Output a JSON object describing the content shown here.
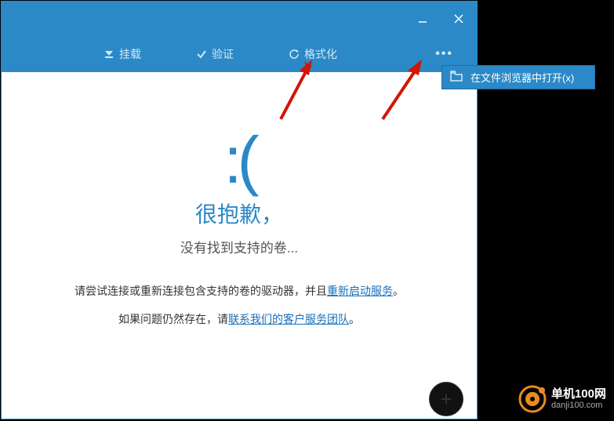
{
  "titlebar": {
    "minimize": "minimize",
    "close": "close"
  },
  "toolbar": {
    "mount_label": "挂载",
    "verify_label": "验证",
    "format_label": "格式化",
    "more_label": "•••"
  },
  "dropdown": {
    "open_in_explorer": "在文件浏览器中打开(x)"
  },
  "content": {
    "sad_face": ":(",
    "sorry": "很抱歉，",
    "no_volume": "没有找到支持的卷...",
    "line1_prefix": "请尝试连接或重新连接包含支持的卷的驱动器，并且",
    "line1_link": "重新启动服务",
    "line1_suffix": "。",
    "line2_prefix": "如果问题仍然存在，请",
    "line2_link": "联系我们的客户服务团队",
    "line2_suffix": "。"
  },
  "watermark": {
    "site": "单机100网",
    "domain": "danji100.com"
  },
  "colors": {
    "accent": "#2c89c7",
    "arrow": "#d11507"
  }
}
